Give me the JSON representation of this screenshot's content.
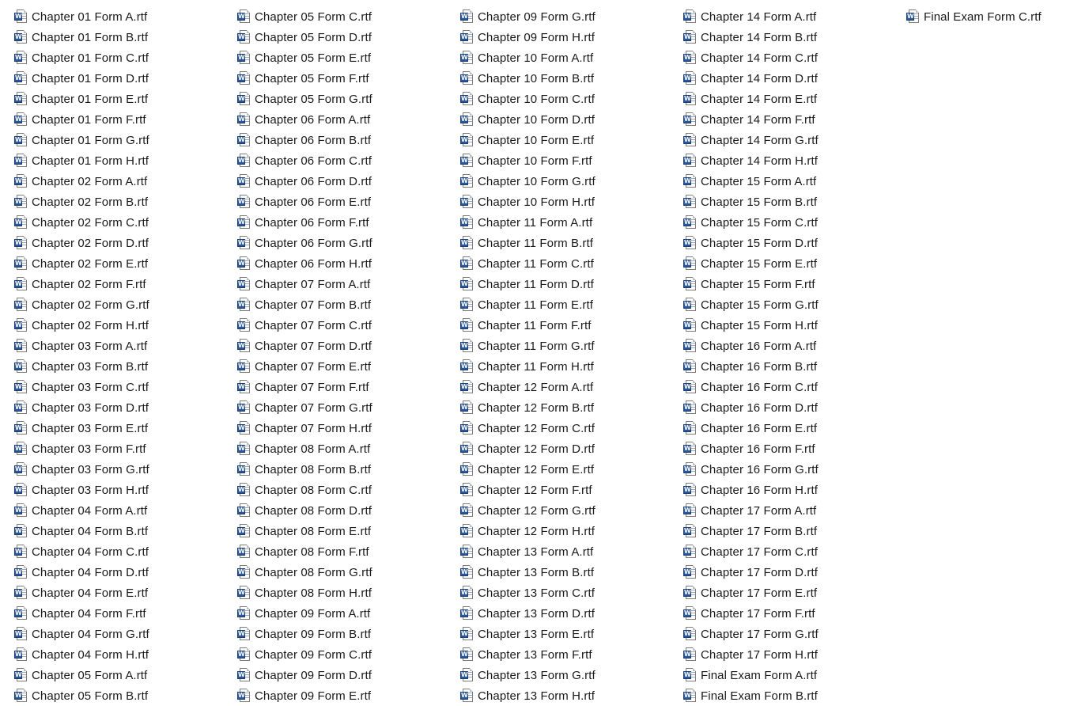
{
  "file_icon": {
    "name": "word-document-icon",
    "letter": "W",
    "accent": "#2b5797"
  },
  "columns": [
    [
      "Chapter 01  Form A.rtf",
      "Chapter 01  Form B.rtf",
      "Chapter 01  Form C.rtf",
      "Chapter 01  Form D.rtf",
      "Chapter 01  Form E.rtf",
      "Chapter 01  Form F.rtf",
      "Chapter 01  Form G.rtf",
      "Chapter 01  Form H.rtf",
      "Chapter 02  Form A.rtf",
      "Chapter 02  Form B.rtf",
      "Chapter 02  Form C.rtf",
      "Chapter 02  Form D.rtf",
      "Chapter 02  Form E.rtf",
      "Chapter 02  Form F.rtf",
      "Chapter 02  Form G.rtf",
      "Chapter 02  Form H.rtf",
      "Chapter 03  Form A.rtf",
      "Chapter 03  Form B.rtf",
      "Chapter 03  Form C.rtf",
      "Chapter 03  Form D.rtf",
      "Chapter 03  Form E.rtf",
      "Chapter 03  Form F.rtf",
      "Chapter 03  Form G.rtf",
      "Chapter 03  Form H.rtf",
      "Chapter 04  Form A.rtf",
      "Chapter 04  Form B.rtf",
      "Chapter 04  Form C.rtf",
      "Chapter 04  Form D.rtf",
      "Chapter 04  Form E.rtf",
      "Chapter 04  Form F.rtf",
      "Chapter 04  Form G.rtf",
      "Chapter 04  Form H.rtf",
      "Chapter 05  Form A.rtf",
      "Chapter 05  Form B.rtf"
    ],
    [
      "Chapter 05  Form C.rtf",
      "Chapter 05  Form D.rtf",
      "Chapter 05  Form E.rtf",
      "Chapter 05  Form F.rtf",
      "Chapter 05  Form G.rtf",
      "Chapter 06  Form A.rtf",
      "Chapter 06  Form B.rtf",
      "Chapter 06  Form C.rtf",
      "Chapter 06  Form D.rtf",
      "Chapter 06  Form E.rtf",
      "Chapter 06  Form F.rtf",
      "Chapter 06  Form G.rtf",
      "Chapter 06  Form H.rtf",
      "Chapter 07  Form A.rtf",
      "Chapter 07  Form B.rtf",
      "Chapter 07  Form C.rtf",
      "Chapter 07  Form D.rtf",
      "Chapter 07  Form E.rtf",
      "Chapter 07  Form F.rtf",
      "Chapter 07  Form G.rtf",
      "Chapter 07  Form H.rtf",
      "Chapter 08  Form A.rtf",
      "Chapter 08  Form B.rtf",
      "Chapter 08  Form C.rtf",
      "Chapter 08  Form D.rtf",
      "Chapter 08  Form E.rtf",
      "Chapter 08  Form F.rtf",
      "Chapter 08  Form G.rtf",
      "Chapter 08  Form H.rtf",
      "Chapter 09  Form A.rtf",
      "Chapter 09  Form B.rtf",
      "Chapter 09  Form C.rtf",
      "Chapter 09  Form D.rtf",
      "Chapter 09  Form E.rtf"
    ],
    [
      "Chapter 09  Form G.rtf",
      "Chapter 09  Form H.rtf",
      "Chapter 10  Form A.rtf",
      "Chapter 10  Form B.rtf",
      "Chapter 10  Form C.rtf",
      "Chapter 10  Form D.rtf",
      "Chapter 10  Form E.rtf",
      "Chapter 10  Form F.rtf",
      "Chapter 10  Form G.rtf",
      "Chapter 10  Form H.rtf",
      "Chapter 11  Form A.rtf",
      "Chapter 11  Form B.rtf",
      "Chapter 11  Form C.rtf",
      "Chapter 11  Form D.rtf",
      "Chapter 11  Form E.rtf",
      "Chapter 11  Form F.rtf",
      "Chapter 11  Form G.rtf",
      "Chapter 11  Form H.rtf",
      "Chapter 12  Form A.rtf",
      "Chapter 12  Form B.rtf",
      "Chapter 12  Form C.rtf",
      "Chapter 12  Form D.rtf",
      "Chapter 12  Form E.rtf",
      "Chapter 12  Form F.rtf",
      "Chapter 12  Form G.rtf",
      "Chapter 12  Form H.rtf",
      "Chapter 13  Form A.rtf",
      "Chapter 13  Form B.rtf",
      "Chapter 13  Form C.rtf",
      "Chapter 13  Form D.rtf",
      "Chapter 13  Form E.rtf",
      "Chapter 13  Form F.rtf",
      "Chapter 13  Form G.rtf",
      "Chapter 13  Form H.rtf"
    ],
    [
      "Chapter 14  Form A.rtf",
      "Chapter 14  Form B.rtf",
      "Chapter 14  Form C.rtf",
      "Chapter 14  Form D.rtf",
      "Chapter 14  Form E.rtf",
      "Chapter 14  Form F.rtf",
      "Chapter 14  Form G.rtf",
      "Chapter 14  Form H.rtf",
      "Chapter 15  Form A.rtf",
      "Chapter 15  Form B.rtf",
      "Chapter 15  Form C.rtf",
      "Chapter 15  Form D.rtf",
      "Chapter 15  Form E.rtf",
      "Chapter 15  Form F.rtf",
      "Chapter 15  Form G.rtf",
      "Chapter 15  Form H.rtf",
      "Chapter 16  Form A.rtf",
      "Chapter 16  Form B.rtf",
      "Chapter 16  Form C.rtf",
      "Chapter 16  Form D.rtf",
      "Chapter 16  Form E.rtf",
      "Chapter 16  Form F.rtf",
      "Chapter 16  Form G.rtf",
      "Chapter 16  Form H.rtf",
      "Chapter 17  Form A.rtf",
      "Chapter 17  Form B.rtf",
      "Chapter 17  Form C.rtf",
      "Chapter 17  Form D.rtf",
      "Chapter 17  Form E.rtf",
      "Chapter 17  Form F.rtf",
      "Chapter 17  Form G.rtf",
      "Chapter 17  Form H.rtf",
      "Final Exam  Form A.rtf",
      "Final Exam  Form B.rtf"
    ],
    [
      "Final Exam  Form C.rtf"
    ]
  ]
}
